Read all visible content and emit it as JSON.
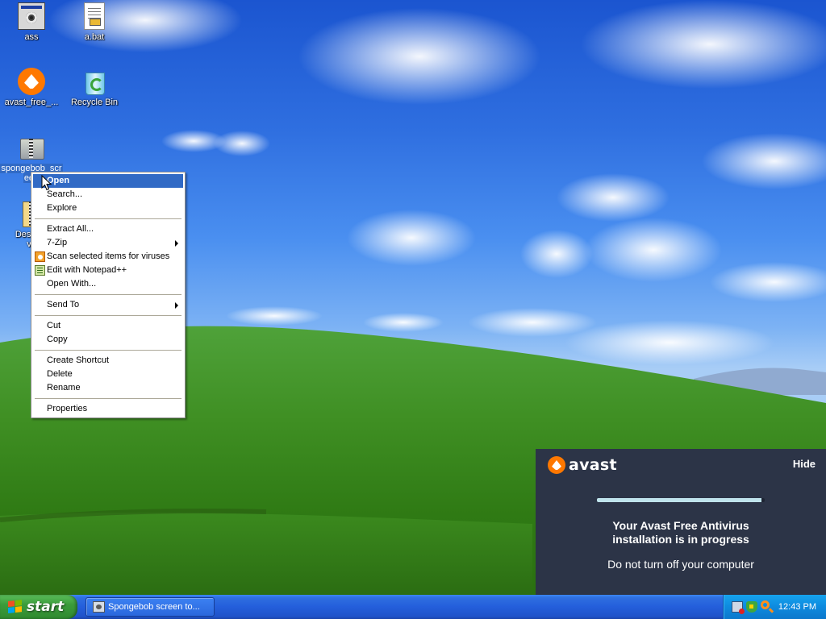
{
  "desktop": {
    "icons": [
      {
        "label": "ass",
        "icon": "program-icon"
      },
      {
        "label": "a.bat",
        "icon": "batch-file-icon"
      },
      {
        "label": "avast_free_...",
        "icon": "avast-installer-icon"
      },
      {
        "label": "Recycle Bin",
        "icon": "recycle-bin-icon"
      },
      {
        "label": "spongebob_scr",
        "label2": "een",
        "icon": "zip-folder-icon"
      },
      {
        "label": "Desktop",
        "label2": "v0",
        "icon": "zip-file-icon"
      }
    ]
  },
  "context_menu": {
    "groups": [
      [
        {
          "label": "Open",
          "highlighted": true
        },
        {
          "label": "Search..."
        },
        {
          "label": "Explore"
        }
      ],
      [
        {
          "label": "Extract All..."
        },
        {
          "label": "7-Zip",
          "submenu": true
        },
        {
          "label": "Scan selected items for viruses",
          "icon": "avast-icon"
        },
        {
          "label": "Edit with Notepad++",
          "icon": "notepad-plus-plus-icon"
        },
        {
          "label": "Open With..."
        }
      ],
      [
        {
          "label": "Send To",
          "submenu": true
        }
      ],
      [
        {
          "label": "Cut"
        },
        {
          "label": "Copy"
        }
      ],
      [
        {
          "label": "Create Shortcut"
        },
        {
          "label": "Delete"
        },
        {
          "label": "Rename"
        }
      ],
      [
        {
          "label": "Properties"
        }
      ]
    ]
  },
  "avast_panel": {
    "logo_text": "avast",
    "hide_label": "Hide",
    "progress": 0.98,
    "title_line1": "Your Avast Free Antivirus",
    "title_line2": "installation is in progress",
    "warning": "Do not turn off your computer",
    "colors": {
      "background": "#2c3447",
      "brand": "#ff7800",
      "progress": "#bfe3ec"
    }
  },
  "taskbar": {
    "start_label": "start",
    "tasks": [
      {
        "label": "Spongebob screen to...",
        "icon": "program-icon"
      }
    ],
    "tray": {
      "icons": [
        "network-icon",
        "avast-shield-icon",
        "search-icon"
      ],
      "clock": "12:43 PM"
    }
  }
}
